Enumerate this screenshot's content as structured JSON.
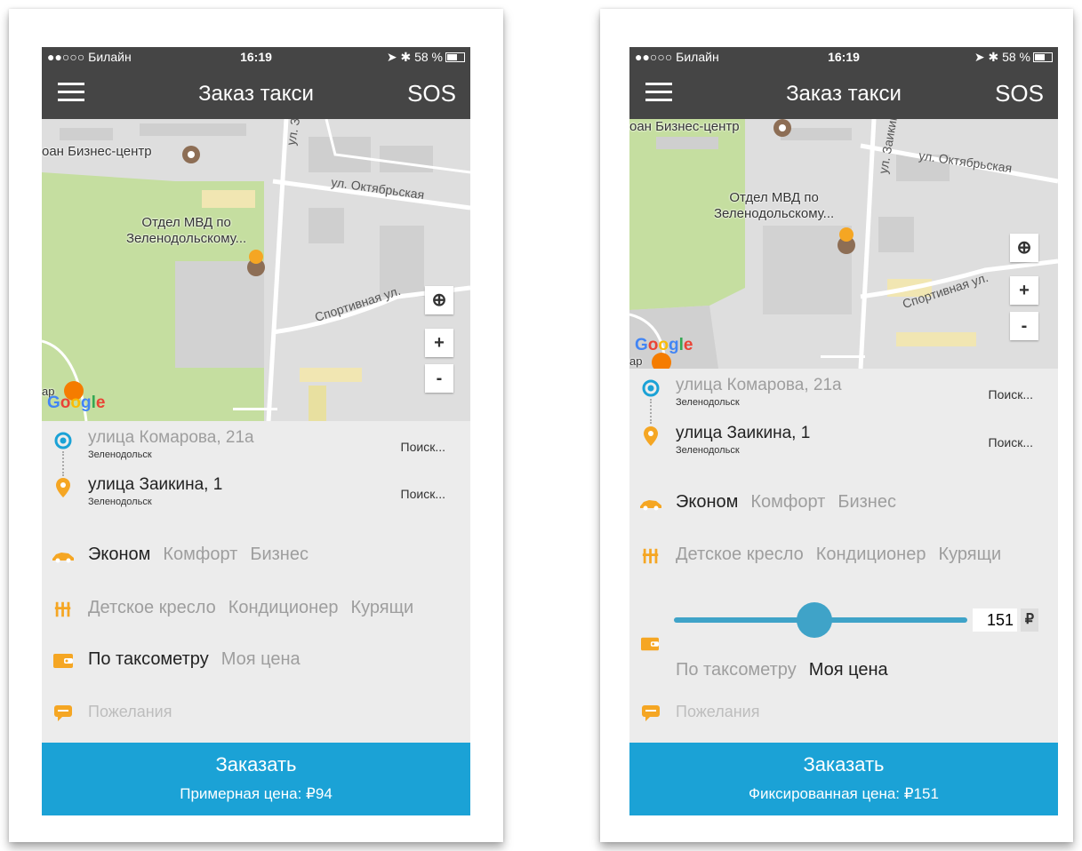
{
  "status": {
    "carrier": "●●○○○ Билайн",
    "time": "16:19",
    "battery": "58 %"
  },
  "appbar": {
    "title": "Заказ такси",
    "sos": "SOS"
  },
  "map": {
    "poi_business": "оан Бизнес-центр",
    "poi_mvd": "Отдел МВД по\nЗеленодольскому...",
    "road_zaikina": "ул. Заикина",
    "road_oktyabrskaya": "ул. Октябрьская",
    "road_sportivnaya": "Спортивная ул.",
    "zoom_in": "+",
    "zoom_out": "-",
    "google": [
      "G",
      "o",
      "o",
      "g",
      "l",
      "e"
    ],
    "bar_label": "ар"
  },
  "route": {
    "from": {
      "address": "улица Комарова, 21а",
      "city": "Зеленодольск",
      "search": "Поиск..."
    },
    "to": {
      "address": "улица Заикина, 1",
      "city": "Зеленодольск",
      "search": "Поиск..."
    }
  },
  "tariffs": [
    "Эконом",
    "Комфорт",
    "Бизнес"
  ],
  "options": [
    "Детское кресло",
    "Кондиционер",
    "Курящи"
  ],
  "payment": [
    "По таксометру",
    "Моя цена"
  ],
  "wishes": "Пожелания",
  "screen1": {
    "order_button": "Заказать",
    "price_text": "Примерная цена: ₽94"
  },
  "screen2": {
    "order_button": "Заказать",
    "price_text": "Фиксированная цена: ₽151",
    "custom_price": "151",
    "currency": "₽",
    "slider_fraction": 0.48
  },
  "colors": {
    "accent": "#1ba2d6",
    "orange": "#f5a623",
    "appbar": "#454545"
  }
}
